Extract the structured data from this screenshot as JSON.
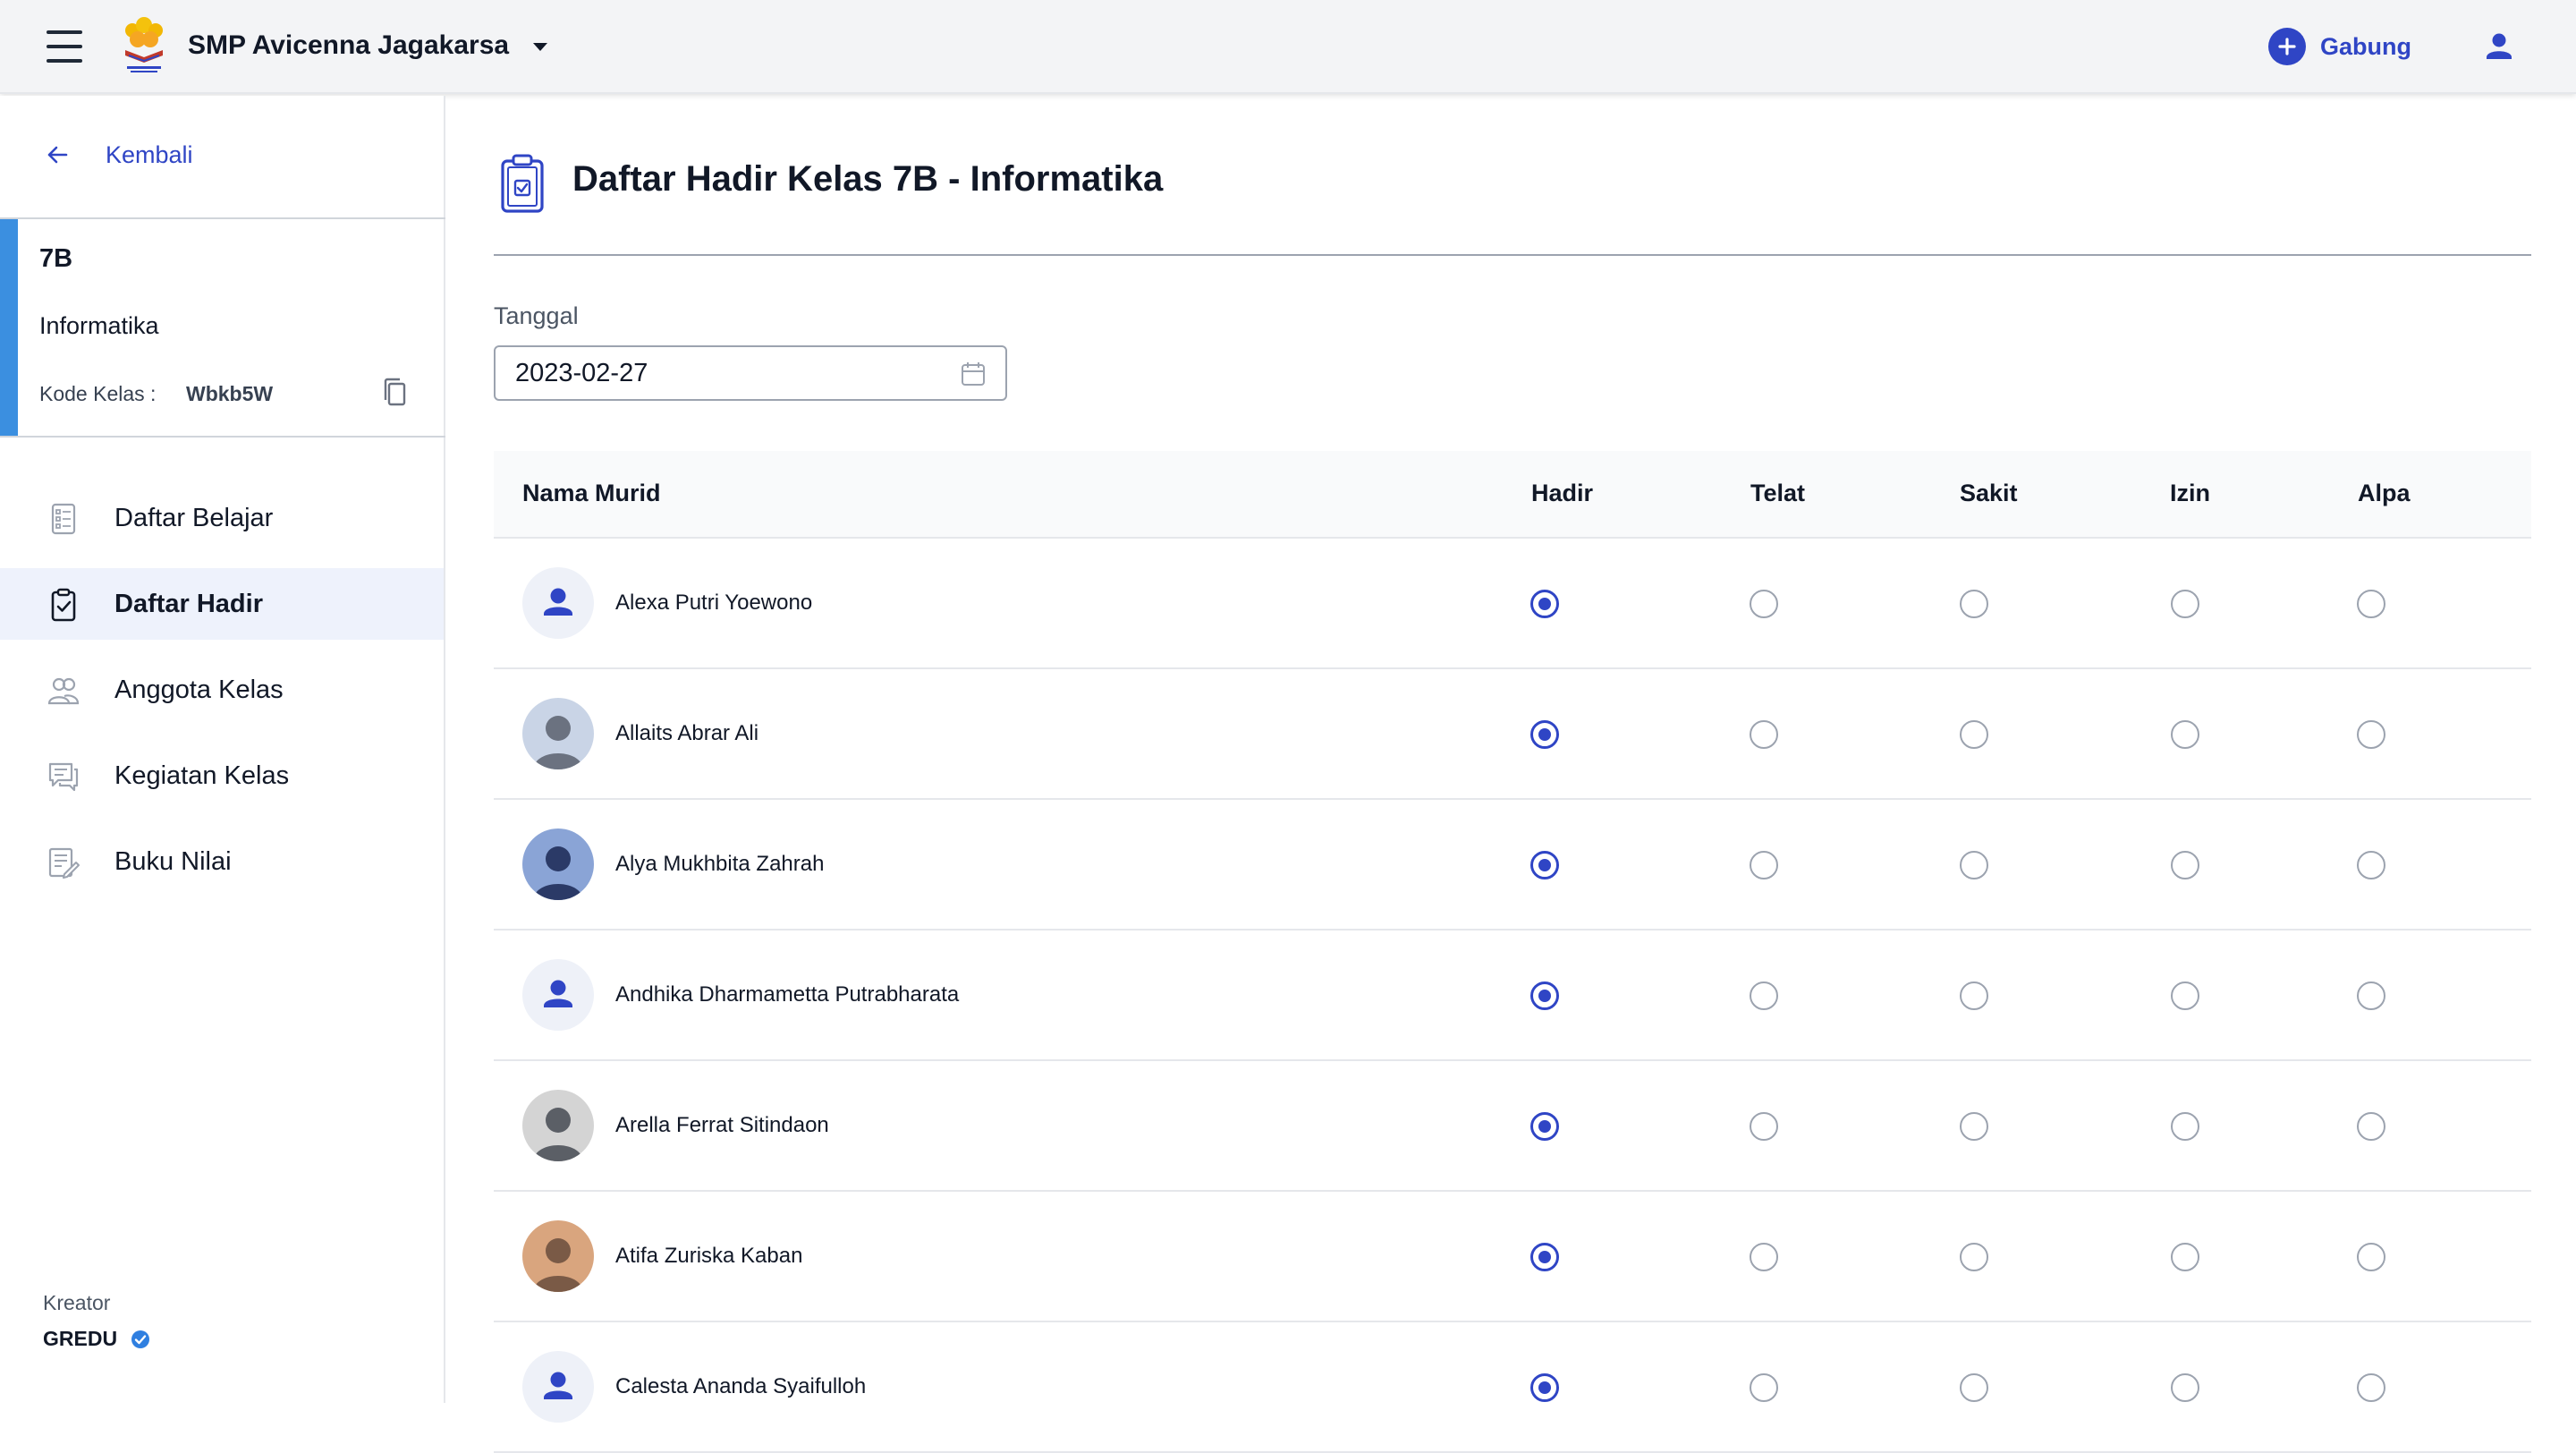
{
  "header": {
    "school_name": "SMP Avicenna Jagakarsa",
    "logo_text": "SEKOLAH AVICENNA",
    "join_label": "Gabung"
  },
  "sidebar": {
    "back_label": "Kembali",
    "class": {
      "name": "7B",
      "subject": "Informatika",
      "code_label": "Kode Kelas :",
      "code_value": "Wbkb5W"
    },
    "items": [
      {
        "label": "Daftar Belajar",
        "icon": "book-list-icon",
        "active": false
      },
      {
        "label": "Daftar Hadir",
        "icon": "clipboard-check-icon",
        "active": true
      },
      {
        "label": "Anggota Kelas",
        "icon": "users-icon",
        "active": false
      },
      {
        "label": "Kegiatan Kelas",
        "icon": "chat-icon",
        "active": false
      },
      {
        "label": "Buku Nilai",
        "icon": "gradebook-icon",
        "active": false
      }
    ],
    "creator_label": "Kreator",
    "creator_name": "GREDU"
  },
  "main": {
    "title": "Daftar Hadir Kelas 7B - Informatika",
    "date_label": "Tanggal",
    "date_value": "2023-02-27",
    "columns": [
      "Nama Murid",
      "Hadir",
      "Telat",
      "Sakit",
      "Izin",
      "Alpa"
    ],
    "students": [
      {
        "name": "Alexa Putri Yoewono",
        "avatar": "default",
        "status": "Hadir"
      },
      {
        "name": "Allaits Abrar Ali",
        "avatar": "photo",
        "status": "Hadir"
      },
      {
        "name": "Alya Mukhbita Zahrah",
        "avatar": "photo",
        "status": "Hadir"
      },
      {
        "name": "Andhika Dharmametta Putrabharata",
        "avatar": "default",
        "status": "Hadir"
      },
      {
        "name": "Arella Ferrat Sitindaon",
        "avatar": "photo",
        "status": "Hadir"
      },
      {
        "name": "Atifa Zuriska Kaban",
        "avatar": "photo",
        "status": "Hadir"
      },
      {
        "name": "Calesta Ananda Syaifulloh",
        "avatar": "default",
        "status": "Hadir"
      }
    ]
  },
  "colors": {
    "accent": "#2f45c5",
    "class_card_accent": "#3b8fe0",
    "active_nav_bg": "#eef2fc"
  }
}
